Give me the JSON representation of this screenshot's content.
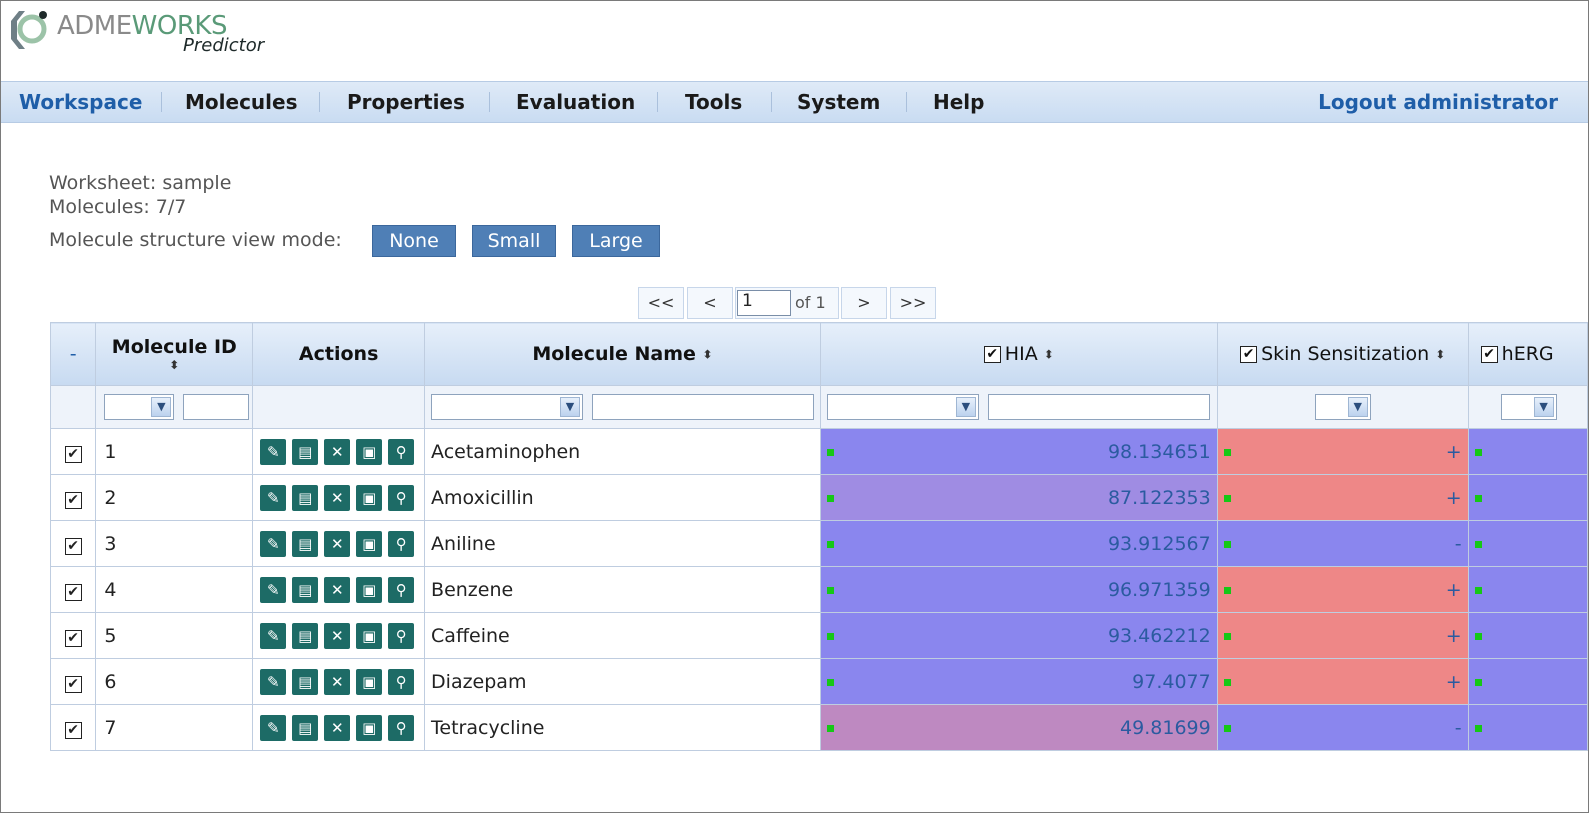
{
  "app": {
    "brand_first": "ADME",
    "brand_second": "WORKS",
    "brand_sub": "Predictor"
  },
  "nav": {
    "items": [
      "Workspace",
      "Molecules",
      "Properties",
      "Evaluation",
      "Tools",
      "System",
      "Help"
    ],
    "active": "Workspace",
    "logout": "Logout administrator"
  },
  "info": {
    "worksheet": "Worksheet: sample",
    "molecules": "Molecules: 7/7",
    "view_mode_label": "Molecule structure view mode:",
    "view_modes": [
      "None",
      "Small",
      "Large"
    ]
  },
  "pager": {
    "first": "<<",
    "prev": "<",
    "page": "1",
    "of": "of 1",
    "next": ">",
    "last": ">>"
  },
  "table": {
    "headers": {
      "select": "-",
      "id": "Molecule ID",
      "actions": "Actions",
      "name": "Molecule Name",
      "hia": "HIA",
      "skin": "Skin Sensitization",
      "herg": "hERG"
    },
    "check_mark": "✔",
    "rows": [
      {
        "id": "1",
        "name": "Acetaminophen",
        "hia": "98.134651",
        "skin": "+"
      },
      {
        "id": "2",
        "name": "Amoxicillin",
        "hia": "87.122353",
        "skin": "+"
      },
      {
        "id": "3",
        "name": "Aniline",
        "hia": "93.912567",
        "skin": "-"
      },
      {
        "id": "4",
        "name": "Benzene",
        "hia": "96.971359",
        "skin": "+"
      },
      {
        "id": "5",
        "name": "Caffeine",
        "hia": "93.462212",
        "skin": "+"
      },
      {
        "id": "6",
        "name": "Diazepam",
        "hia": "97.4077",
        "skin": "+"
      },
      {
        "id": "7",
        "name": "Tetracycline",
        "hia": "49.81699",
        "skin": "-"
      }
    ],
    "action_icons": [
      "edit-icon",
      "document-icon",
      "delete-icon",
      "save-icon",
      "zoom-icon"
    ],
    "colors": {
      "positive": "#ee8787",
      "negative": "#8a86ee",
      "hia_high": "#8a86ee",
      "hia_mid": "#9f8ce3",
      "hia_low": "#be89c1",
      "indicator": "#16c816"
    }
  }
}
